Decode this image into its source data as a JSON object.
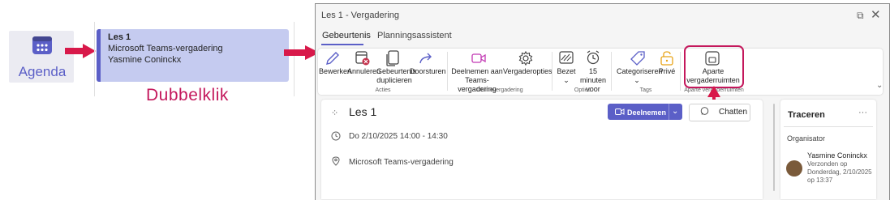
{
  "agenda": {
    "label": "Agenda",
    "icon": "calendar-icon"
  },
  "event": {
    "title": "Les 1",
    "line2": "Microsoft Teams-vergadering",
    "line3": "Yasmine Coninckx"
  },
  "annotation": {
    "text": "Dubbelklik",
    "color": "#c4185c"
  },
  "window": {
    "title": "Les 1 - Vergadering",
    "tabs": [
      {
        "label": "Gebeurtenis",
        "active": true
      },
      {
        "label": "Planningsassistent",
        "active": false
      }
    ]
  },
  "ribbon": {
    "buttons": [
      {
        "label": "Bewerken",
        "icon": "pencil-icon"
      },
      {
        "label": "Annuleren",
        "icon": "cancel-calendar-icon"
      },
      {
        "label": "Gebeurtenis duplicieren",
        "icon": "duplicate-icon"
      },
      {
        "label": "Doorsturen",
        "icon": "forward-icon"
      },
      {
        "label": "Deelnemen aan Teams-vergadering",
        "icon": "video-icon"
      },
      {
        "label": "Vergaderopties",
        "icon": "gear-icon"
      },
      {
        "label": "Bezet",
        "icon": "busy-icon"
      },
      {
        "label": "15 minuten voor",
        "icon": "alarm-icon"
      },
      {
        "label": "Categoriseren",
        "icon": "tag-icon"
      },
      {
        "label": "Privé",
        "icon": "lock-icon"
      },
      {
        "label": "Aparte vergaderruimten",
        "icon": "breakout-rooms-icon"
      }
    ],
    "groups": {
      "acties": "Acties",
      "online": "Onlinevergadering",
      "opties": "Opties",
      "tags": "Tags",
      "aparte": "Aparte vergaderruimten"
    }
  },
  "main": {
    "title": "Les 1",
    "join_label": "Deelnemen",
    "chat_label": "Chatten",
    "date": "Do 2/10/2025 14:00 - 14:30",
    "location": "Microsoft Teams-vergadering"
  },
  "side": {
    "title": "Traceren",
    "more": "···",
    "organizer_label": "Organisator",
    "organizer_name": "Yasmine Coninckx",
    "sent": "Verzonden op Donderdag, 2/10/2025 op 13:37"
  },
  "colors": {
    "accent": "#5b5fc7",
    "highlight": "#c4185c",
    "event_bg": "#c5cbf0"
  }
}
